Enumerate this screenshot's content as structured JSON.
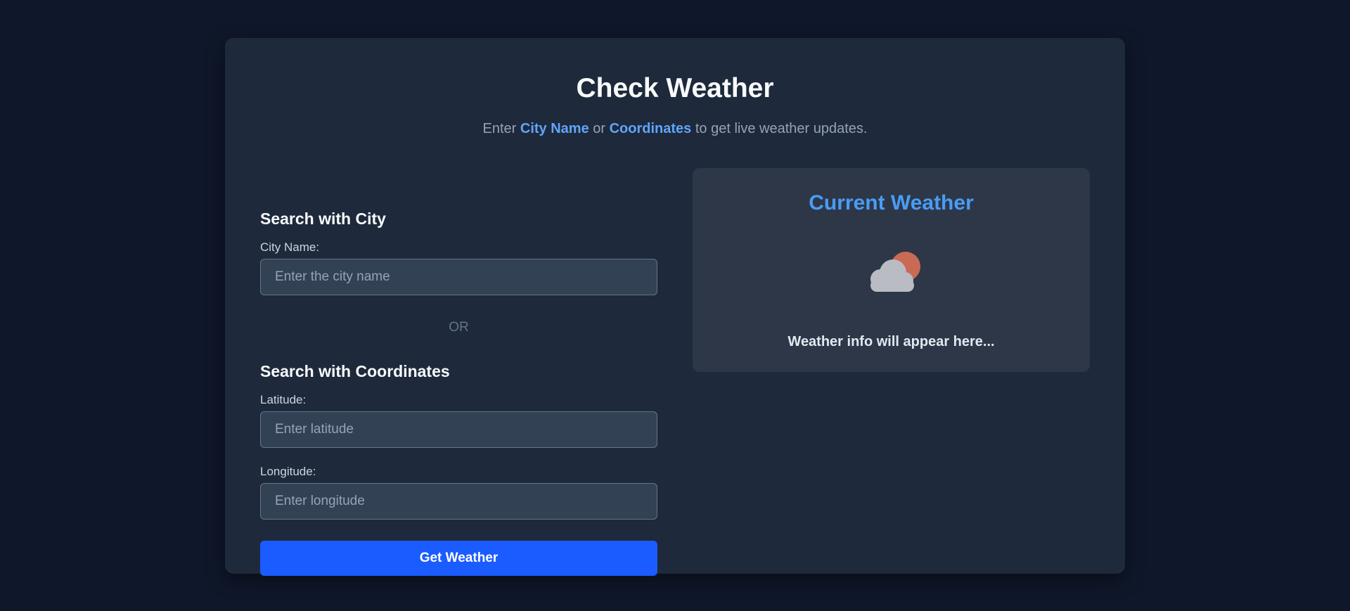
{
  "header": {
    "title": "Check Weather",
    "subtitle_prefix": "Enter ",
    "subtitle_city": "City Name",
    "subtitle_or": " or ",
    "subtitle_coords": "Coordinates",
    "subtitle_suffix": " to get live weather updates."
  },
  "city_search": {
    "heading": "Search with City",
    "label": "City Name:",
    "placeholder": "Enter the city name",
    "value": ""
  },
  "divider": {
    "text": "OR"
  },
  "coord_search": {
    "heading": "Search with Coordinates",
    "latitude_label": "Latitude:",
    "latitude_placeholder": "Enter latitude",
    "longitude_label": "Longitude:",
    "longitude_placeholder": "Enter longitude"
  },
  "actions": {
    "submit_label": "Get Weather"
  },
  "weather_panel": {
    "title": "Current Weather",
    "icon": "partly-cloudy-icon",
    "message": "Weather info will appear here..."
  },
  "colors": {
    "page_bg": "#0f172a",
    "card_bg": "#1e293b",
    "panel_bg": "#2d3748",
    "accent": "#60a5fa",
    "button": "#1a5cff",
    "sun": "#c96a55",
    "cloud": "#b9bcc2"
  }
}
